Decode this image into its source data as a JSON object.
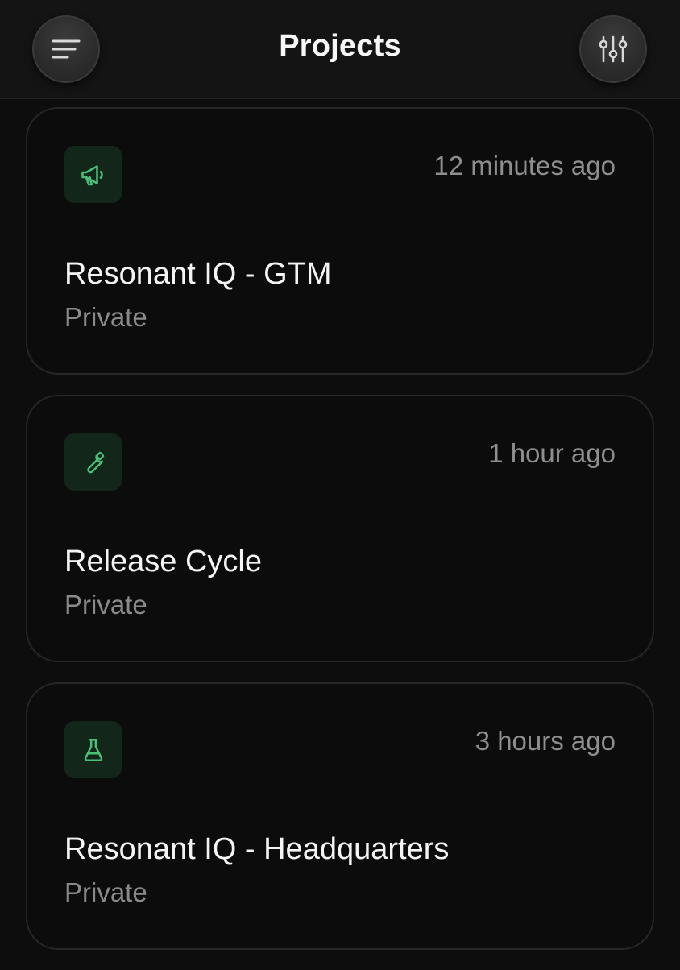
{
  "header": {
    "title": "Projects",
    "menu_icon": "menu-icon",
    "filter_icon": "sliders-icon"
  },
  "colors": {
    "background": "#0d0d0d",
    "accent_green": "#4bbf78",
    "icon_tile_bg": "#13261a",
    "muted_text": "#8e8e8e"
  },
  "projects": [
    {
      "name": "Resonant IQ - GTM",
      "visibility": "Private",
      "updated": "12 minutes ago",
      "icon": "megaphone-icon"
    },
    {
      "name": "Release Cycle",
      "visibility": "Private",
      "updated": "1 hour ago",
      "icon": "wrench-icon"
    },
    {
      "name": "Resonant IQ - Headquarters",
      "visibility": "Private",
      "updated": "3 hours ago",
      "icon": "flask-icon"
    }
  ]
}
